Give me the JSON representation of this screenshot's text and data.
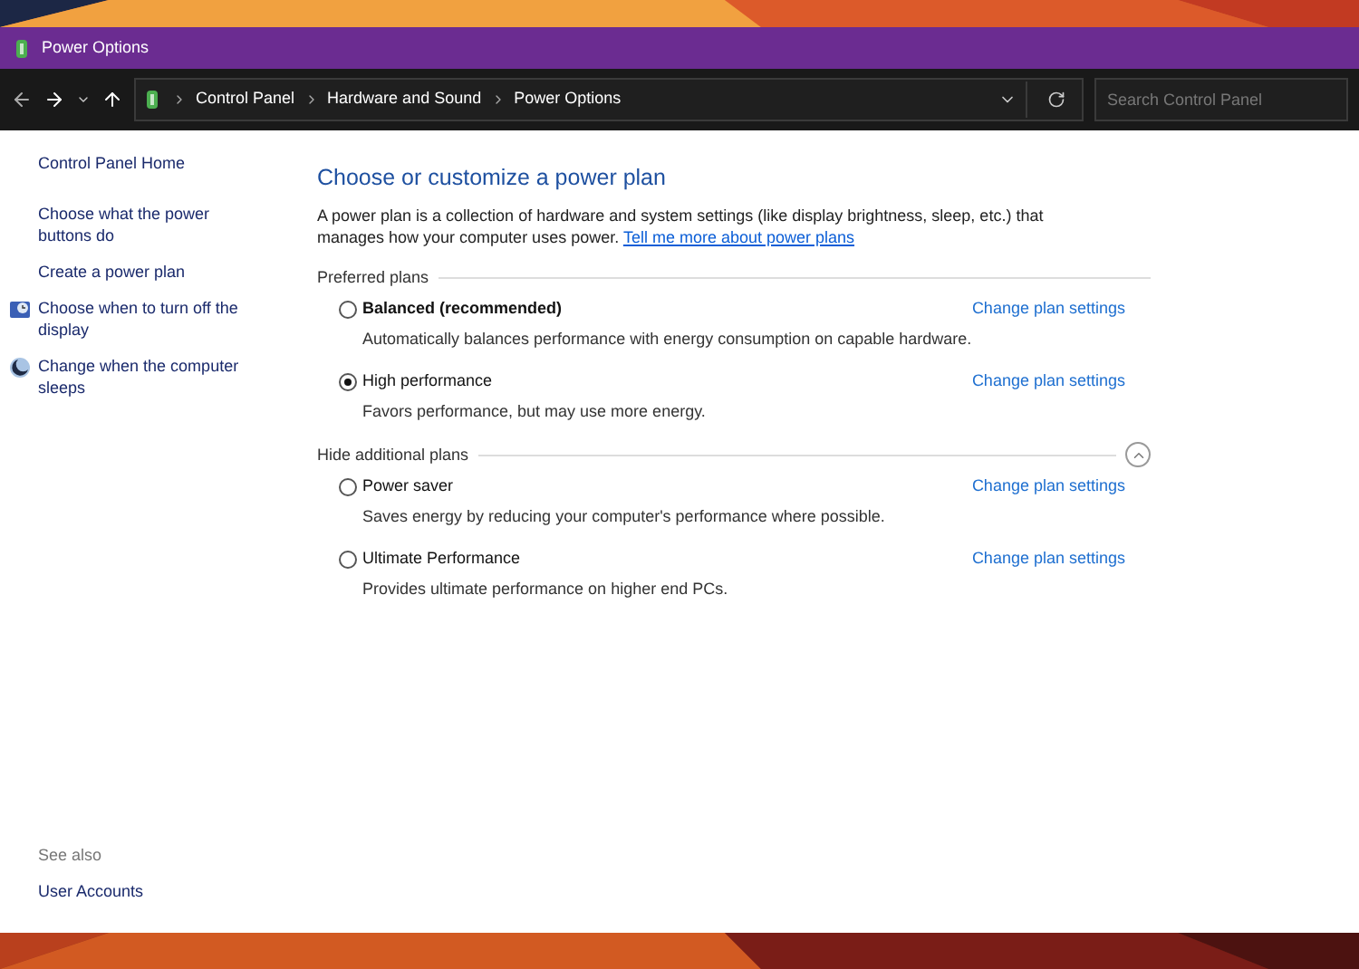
{
  "window": {
    "title": "Power Options"
  },
  "address_bar": {
    "breadcrumbs": [
      "Control Panel",
      "Hardware and Sound",
      "Power Options"
    ],
    "search": {
      "placeholder": "Search Control Panel"
    }
  },
  "sidebar": {
    "items": [
      {
        "label": "Control Panel Home",
        "kind": "home"
      },
      {
        "label": "Choose what the power buttons do",
        "kind": "plain"
      },
      {
        "label": "Create a power plan",
        "kind": "plain"
      },
      {
        "label": "Choose when to turn off the display",
        "kind": "display"
      },
      {
        "label": "Change when the computer sleeps",
        "kind": "sleep"
      }
    ],
    "see_also": {
      "heading": "See also",
      "links": [
        "User Accounts"
      ]
    }
  },
  "main": {
    "title": "Choose or customize a power plan",
    "intro": "A power plan is a collection of hardware and system settings (like display brightness, sleep, etc.) that manages how your computer uses power.",
    "intro_link": "Tell me more about power plans",
    "groups": [
      {
        "heading": "Preferred plans",
        "collapse_button": false,
        "plans": [
          {
            "name": "Balanced (recommended)",
            "bold": true,
            "selected": false,
            "description": "Automatically balances performance with energy consumption on capable hardware.",
            "link": "Change plan settings"
          },
          {
            "name": "High performance",
            "bold": false,
            "selected": true,
            "description": "Favors performance, but may use more energy.",
            "link": "Change plan settings"
          }
        ]
      },
      {
        "heading": "Hide additional plans",
        "collapse_button": true,
        "plans": [
          {
            "name": "Power saver",
            "bold": false,
            "selected": false,
            "description": "Saves energy by reducing your computer's performance where possible.",
            "link": "Change plan settings"
          },
          {
            "name": "Ultimate Performance",
            "bold": false,
            "selected": false,
            "description": "Provides ultimate performance on higher end PCs.",
            "link": "Change plan settings"
          }
        ]
      }
    ]
  }
}
